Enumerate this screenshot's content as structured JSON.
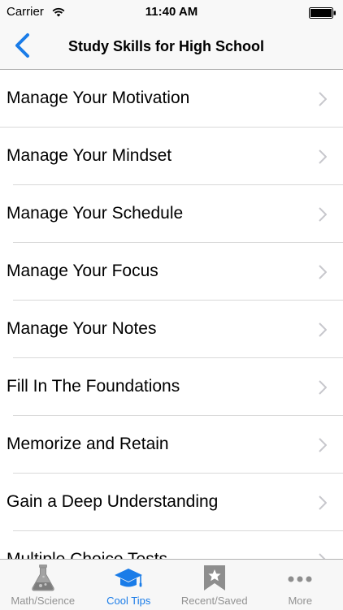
{
  "status_bar": {
    "carrier": "Carrier",
    "time": "11:40 AM"
  },
  "nav": {
    "title": "Study Skills for High School",
    "back_icon": "chevron-left-icon"
  },
  "list": {
    "items": [
      {
        "label": "Manage Your Motivation"
      },
      {
        "label": "Manage Your Mindset"
      },
      {
        "label": "Manage Your Schedule"
      },
      {
        "label": "Manage Your Focus"
      },
      {
        "label": "Manage Your Notes"
      },
      {
        "label": "Fill In The Foundations"
      },
      {
        "label": "Memorize and Retain"
      },
      {
        "label": "Gain a Deep Understanding"
      },
      {
        "label": "Multiple Choice Tests"
      }
    ]
  },
  "tabs": [
    {
      "label": "Math/Science",
      "icon": "flask-icon"
    },
    {
      "label": "Cool Tips",
      "icon": "graduation-cap-icon",
      "active": true
    },
    {
      "label": "Recent/Saved",
      "icon": "bookmark-icon"
    },
    {
      "label": "More",
      "icon": "more-dots-icon"
    }
  ],
  "colors": {
    "accent": "#1a7ce8",
    "inactive_tab": "#929292"
  }
}
